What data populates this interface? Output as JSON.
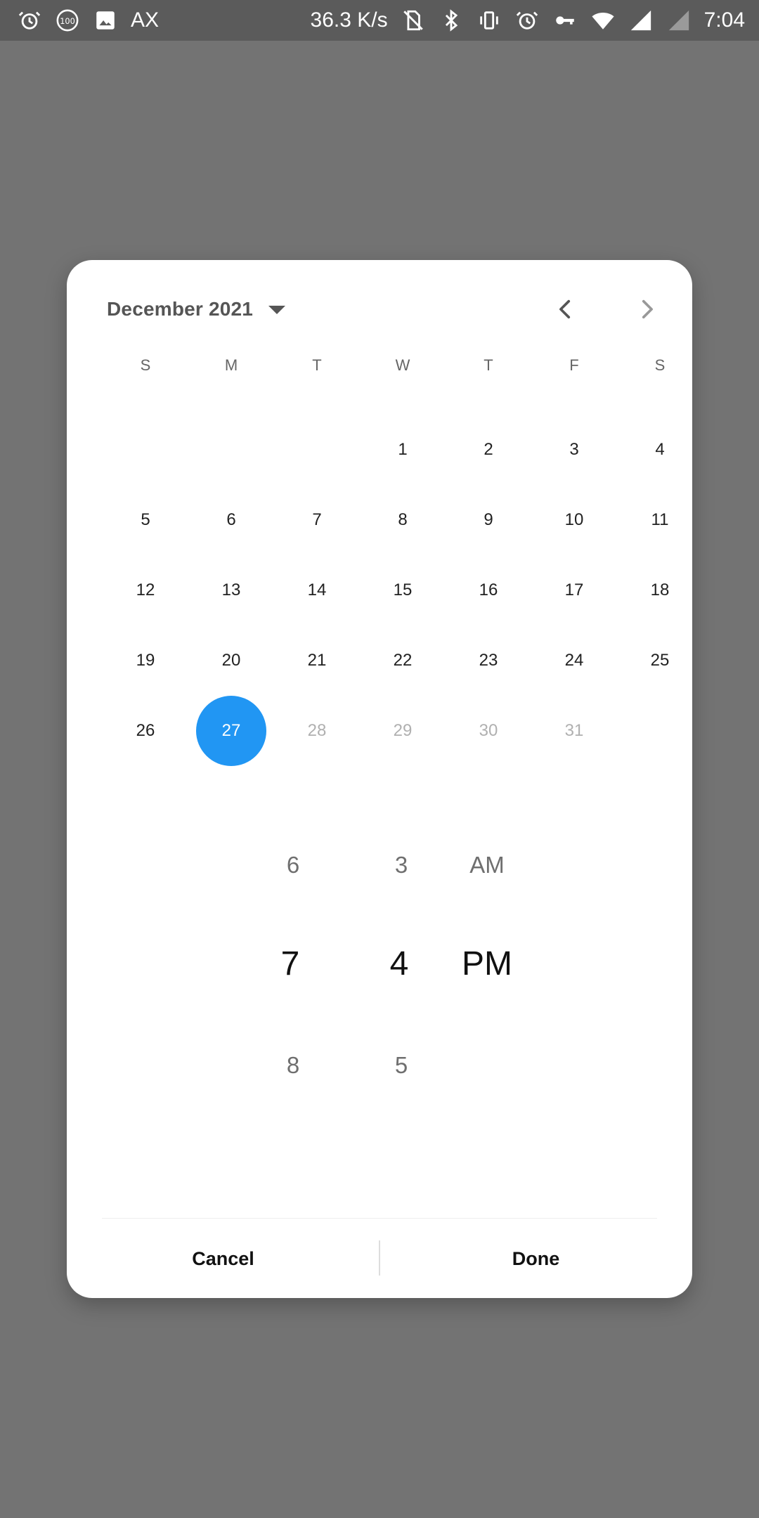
{
  "status_bar": {
    "left_icons": [
      "alarm-icon",
      "battery-100-icon",
      "image-icon"
    ],
    "left_text": "AX",
    "network_speed": "36.3 K/s",
    "right_icons": [
      "no-sim-icon",
      "bluetooth-icon",
      "vibrate-icon",
      "alarm-icon",
      "vpn-key-icon",
      "wifi-icon",
      "signal-icon",
      "no-signal-icon"
    ],
    "time": "7:04"
  },
  "header": {
    "month_label": "December 2021",
    "prev_icon": "chevron-left-icon",
    "next_icon": "chevron-right-icon"
  },
  "weekdays": [
    "S",
    "M",
    "T",
    "W",
    "T",
    "F",
    "S"
  ],
  "calendar": {
    "selected_day": "27",
    "selected_color": "#2196f3",
    "weeks": [
      [
        "",
        "",
        "",
        "1",
        "2",
        "3",
        "4"
      ],
      [
        "5",
        "6",
        "7",
        "8",
        "9",
        "10",
        "11"
      ],
      [
        "12",
        "13",
        "14",
        "15",
        "16",
        "17",
        "18"
      ],
      [
        "19",
        "20",
        "21",
        "22",
        "23",
        "24",
        "25"
      ],
      [
        "26",
        "27",
        "28",
        "29",
        "30",
        "31",
        ""
      ]
    ],
    "dimmed_days": [
      "28",
      "29",
      "30",
      "31"
    ]
  },
  "time_picker": {
    "hour": {
      "prev": "6",
      "selected": "7",
      "next": "8"
    },
    "minute": {
      "prev": "3",
      "selected": "4",
      "next": "5"
    },
    "period": {
      "prev": "AM",
      "selected": "PM"
    }
  },
  "footer": {
    "cancel_label": "Cancel",
    "done_label": "Done"
  }
}
